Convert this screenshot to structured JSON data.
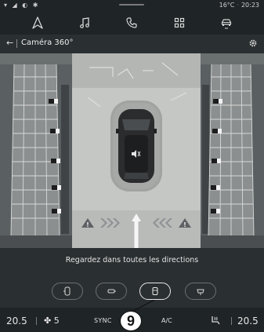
{
  "status_bar": {
    "left_icons": "▾ ◢ ◐ ✱",
    "temperature": "16°C",
    "time": "20:23"
  },
  "top_nav": {
    "items": [
      {
        "icon": "navigation-icon"
      },
      {
        "icon": "music-note-icon"
      },
      {
        "icon": "phone-icon"
      },
      {
        "icon": "apps-grid-icon"
      },
      {
        "icon": "car-icon"
      }
    ]
  },
  "header": {
    "back": "←",
    "title": "Caméra 360°"
  },
  "camera": {
    "warning_symbol": "⚠"
  },
  "instruction": "Regardez dans toutes les directions",
  "view_buttons": [
    {
      "icon": "side-view-icon",
      "selected": false
    },
    {
      "icon": "front-view-icon",
      "selected": false
    },
    {
      "icon": "top-view-icon",
      "selected": true
    },
    {
      "icon": "rear-view-icon",
      "selected": false
    }
  ],
  "climate": {
    "temp_left": "20.5",
    "fan_speed": "5",
    "sync_label": "SYNC",
    "ac_label": "A/C",
    "temp_right": "20.5"
  },
  "callout": "9"
}
